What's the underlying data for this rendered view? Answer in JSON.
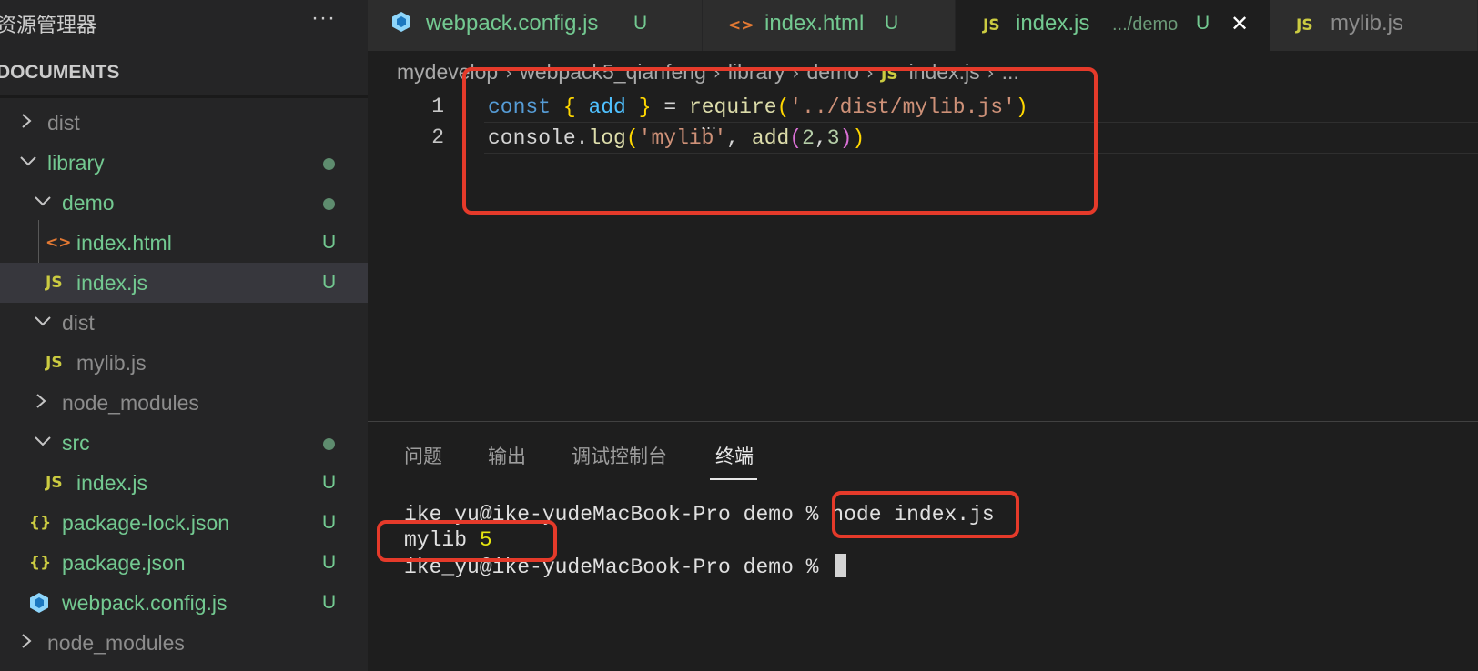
{
  "sidebar": {
    "title": "资源管理器",
    "more_label": "···",
    "section": "DOCUMENTS",
    "items": [
      {
        "label": "dist",
        "badge": ""
      },
      {
        "label": "library",
        "badge": ""
      },
      {
        "label": "demo",
        "badge": ""
      },
      {
        "label": "index.html",
        "badge": "U",
        "icon": "<>"
      },
      {
        "label": "index.js",
        "badge": "U",
        "icon": "JS"
      },
      {
        "label": "dist",
        "badge": ""
      },
      {
        "label": "mylib.js",
        "badge": "",
        "icon": "JS"
      },
      {
        "label": "node_modules",
        "badge": ""
      },
      {
        "label": "src",
        "badge": ""
      },
      {
        "label": "index.js",
        "badge": "U",
        "icon": "JS"
      },
      {
        "label": "package-lock.json",
        "badge": "U",
        "icon": "{}"
      },
      {
        "label": "package.json",
        "badge": "U",
        "icon": "{}"
      },
      {
        "label": "webpack.config.js",
        "badge": "U",
        "icon": "webpack-icon"
      },
      {
        "label": "node_modules",
        "badge": ""
      }
    ]
  },
  "tabs": [
    {
      "label": "webpack.config.js",
      "badge": "U",
      "icon": "webpack-icon"
    },
    {
      "label": "index.html",
      "badge": "U",
      "icon": "<>"
    },
    {
      "label": "index.js",
      "desc": ".../demo",
      "badge": "U",
      "icon": "JS",
      "close": "✕"
    },
    {
      "label": "mylib.js",
      "icon": "JS"
    }
  ],
  "breadcrumb": [
    "mydevelop",
    "webpack5_qianfeng",
    "library",
    "demo",
    "index.js",
    "..."
  ],
  "editor": {
    "line_numbers": [
      "1",
      "2"
    ],
    "line1": {
      "kw": "const",
      "brace_open": "{",
      "var": "add",
      "brace_close": "}",
      "eq": "=",
      "fn": "require",
      "p_open": "(",
      "str": "'../dist/mylib.js'",
      "p_close": ")"
    },
    "line2": {
      "obj": "console",
      "dot": ".",
      "fn": "log",
      "p_open": "(",
      "str": "'mylib'",
      "comma": ", ",
      "fn2": "add",
      "p2_open": "(",
      "n1": "2",
      "c2": ",",
      "n2": "3",
      "p2_close": ")",
      "p_close": ")"
    },
    "hint": "..."
  },
  "panel": {
    "tabs": [
      "问题",
      "输出",
      "调试控制台",
      "终端"
    ],
    "active_tab": "终端",
    "terminal": {
      "line1_prompt": "ike_yu@ike-yudeMacBook-Pro demo % ",
      "line1_cmd": "node index.js",
      "line2_text": "mylib ",
      "line2_num": "5",
      "line3_prompt": "ike_yu@ike-yudeMacBook-Pro demo % "
    }
  },
  "colors": {
    "highlight_box": "#e53a2a",
    "untracked": "#73c991",
    "js_icon": "#cbcb41"
  }
}
